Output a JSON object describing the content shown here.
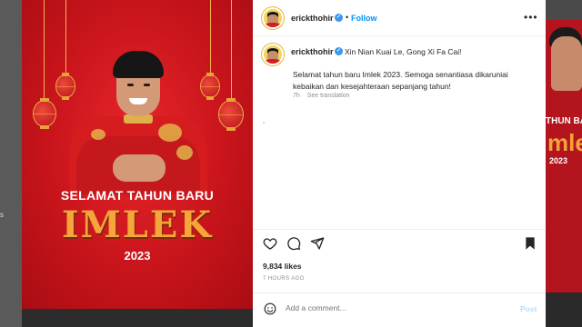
{
  "background": {
    "left_text": "s"
  },
  "post_image": {
    "greeting_line1": "SELAMAT TAHUN BARU",
    "greeting_line2": "IMLEK",
    "greeting_year": "2023"
  },
  "background_right": {
    "text1": "THUN BARU",
    "text2": "mlek",
    "text3": "2023"
  },
  "header": {
    "username": "erickthohir",
    "follow_label": "Follow",
    "more_icon": "more-horizontal-icon"
  },
  "caption": {
    "username": "erickthohir",
    "title": "Xin Nian Kuai Le, Gong Xi Fa Cai!",
    "body": "Selamat tahun baru Imlek 2023. Semoga senantiasa dikaruniai kebaikan dan kesejahteraan sepanjang tahun!",
    "time": "7h",
    "see_translation": "See translation"
  },
  "actions": {
    "icons": [
      "heart-icon",
      "comment-icon",
      "share-icon",
      "bookmark-icon"
    ],
    "likes": "9,834 likes",
    "posted": "7 HOURS AGO"
  },
  "comment": {
    "placeholder": "Add a comment...",
    "post_label": "Post",
    "emoji_icon": "smiley-icon"
  },
  "colors": {
    "accent": "#0095f6",
    "verified": "#3897f0",
    "poster_red": "#c8141b",
    "poster_gold": "#f5a53a"
  }
}
